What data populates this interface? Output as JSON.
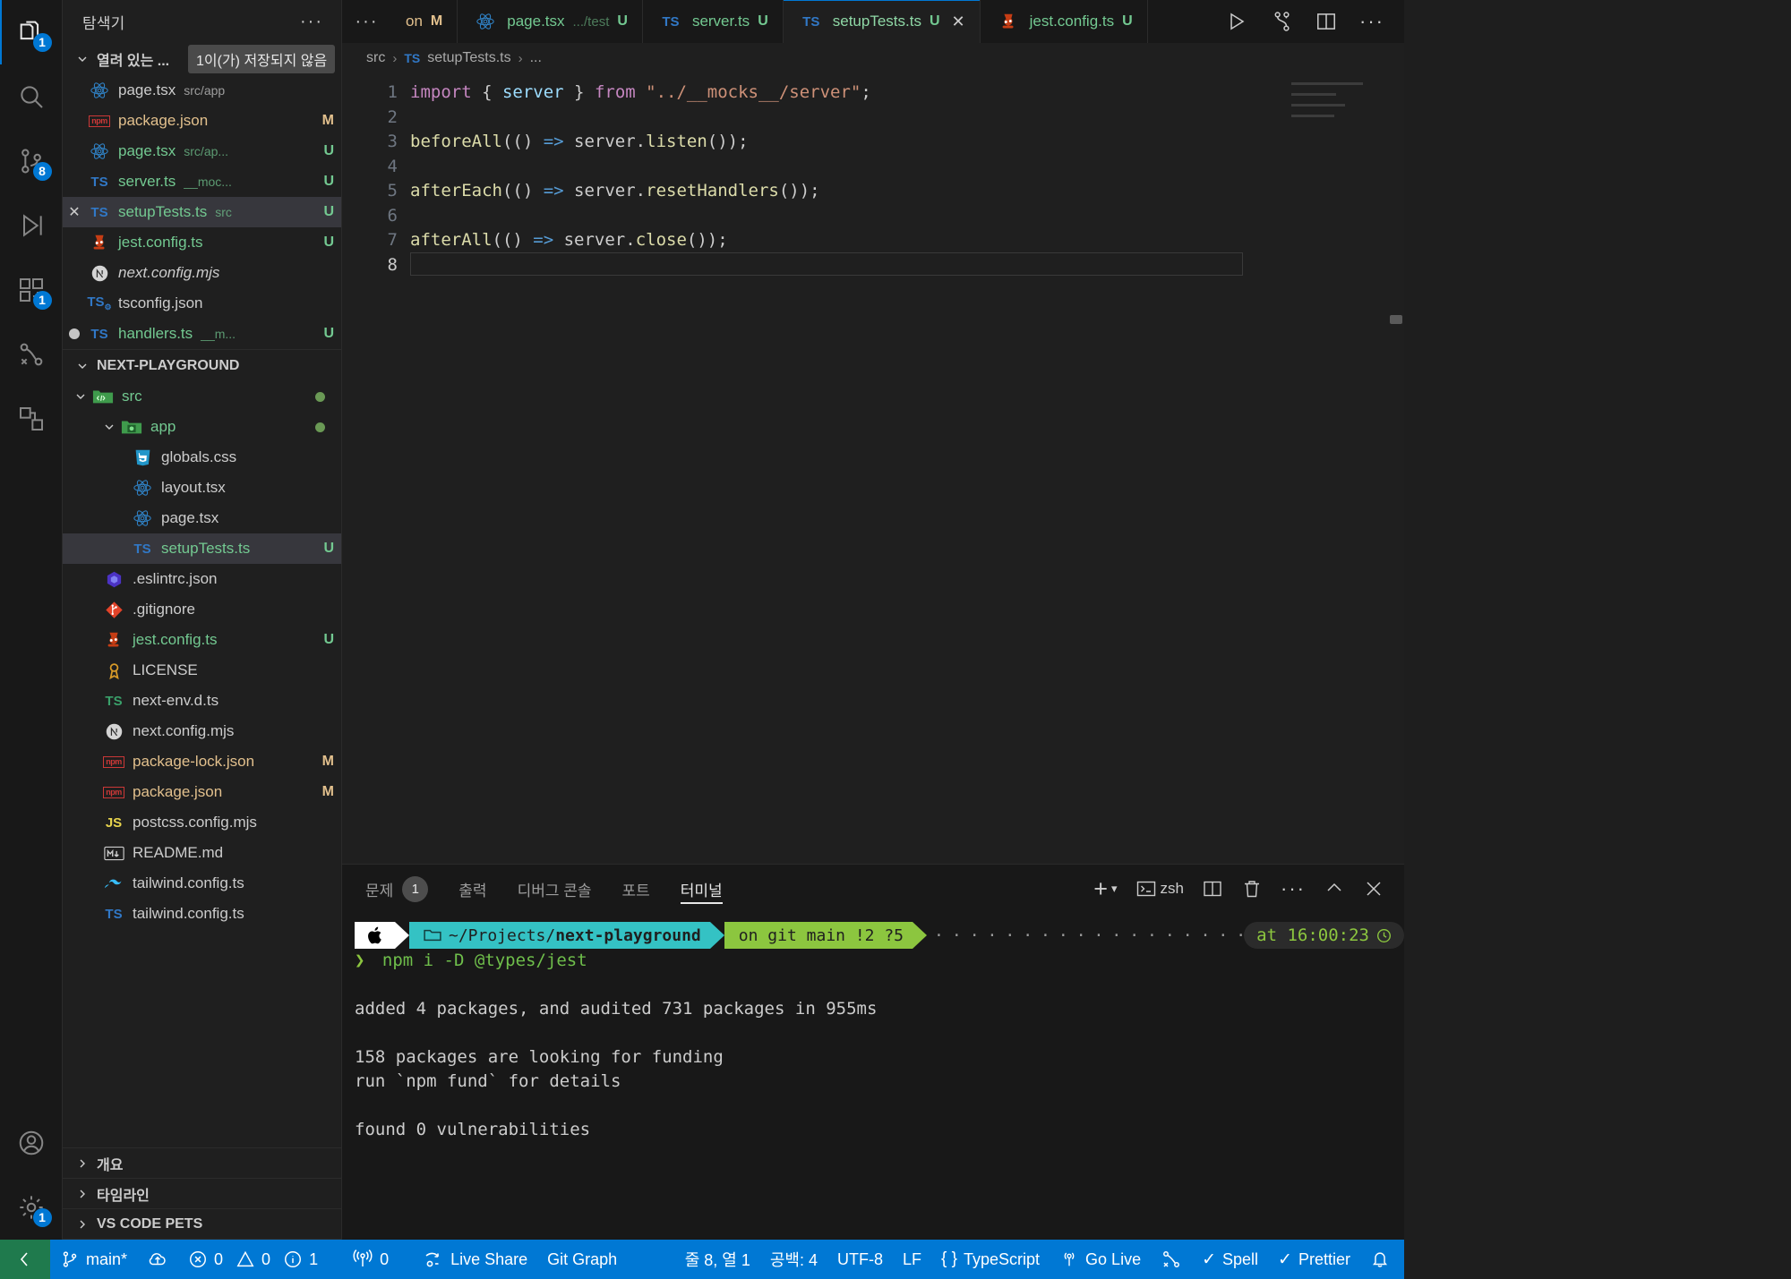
{
  "activity_bar": {
    "items": [
      {
        "name": "explorer",
        "icon": "files-icon",
        "badge": "1",
        "active": true
      },
      {
        "name": "search",
        "icon": "search-icon",
        "badge": ""
      },
      {
        "name": "source-control",
        "icon": "source-control-icon",
        "badge": "8"
      },
      {
        "name": "run-and-debug",
        "icon": "debug-icon",
        "badge": ""
      },
      {
        "name": "extensions",
        "icon": "extensions-icon",
        "badge": "1"
      },
      {
        "name": "remote-explorer",
        "icon": "remote-icon",
        "badge": ""
      },
      {
        "name": "test-explorer",
        "icon": "beaker-icon",
        "badge": ""
      }
    ],
    "bottom": [
      {
        "name": "accounts",
        "icon": "account-icon",
        "badge": ""
      },
      {
        "name": "manage",
        "icon": "gear-icon",
        "badge": "1"
      }
    ]
  },
  "sidebar": {
    "title": "탐색기",
    "more_actions": "···",
    "open_editors": {
      "label": "열려 있는 ...",
      "tooltip": "1이(가) 저장되지 않음",
      "items": [
        {
          "icon": "react-icon",
          "name": "page.tsx",
          "desc": "src/app",
          "badge": "",
          "color": "grey",
          "state": ""
        },
        {
          "icon": "npm-icon",
          "name": "package.json",
          "desc": "",
          "badge": "M",
          "color": "orange",
          "state": ""
        },
        {
          "icon": "react-icon",
          "name": "page.tsx",
          "desc": "src/ap...",
          "badge": "U",
          "color": "green",
          "state": ""
        },
        {
          "icon": "ts-icon",
          "name": "server.ts",
          "desc": "__moc...",
          "badge": "U",
          "color": "green",
          "state": ""
        },
        {
          "icon": "ts-icon",
          "name": "setupTests.ts",
          "desc": "src",
          "badge": "U",
          "color": "green",
          "state": "selected"
        },
        {
          "icon": "jest-icon",
          "name": "jest.config.ts",
          "desc": "",
          "badge": "U",
          "color": "green",
          "state": ""
        },
        {
          "icon": "next-icon",
          "name": "next.config.mjs",
          "desc": "",
          "badge": "",
          "color": "grey",
          "state": "italic"
        },
        {
          "icon": "tsconfig-icon",
          "name": "tsconfig.json",
          "desc": "",
          "badge": "",
          "color": "grey",
          "state": ""
        },
        {
          "icon": "ts-icon",
          "name": "handlers.ts",
          "desc": "__m...",
          "badge": "U",
          "color": "green",
          "state": "dirty"
        }
      ]
    },
    "workspace": {
      "label": "NEXT-PLAYGROUND",
      "items": [
        {
          "icon": "folder-src-icon",
          "name": "src",
          "badge": "",
          "color": "green",
          "indent": 1,
          "expanded": true,
          "dot": "#6a9955"
        },
        {
          "icon": "folder-app-icon",
          "name": "app",
          "badge": "",
          "color": "green",
          "indent": 2,
          "expanded": true,
          "dot": "#6a9955"
        },
        {
          "icon": "css-icon",
          "name": "globals.css",
          "badge": "",
          "color": "grey",
          "indent": 3
        },
        {
          "icon": "react-icon",
          "name": "layout.tsx",
          "badge": "",
          "color": "grey",
          "indent": 3
        },
        {
          "icon": "react-icon",
          "name": "page.tsx",
          "badge": "",
          "color": "grey",
          "indent": 3
        },
        {
          "icon": "ts-icon",
          "name": "setupTests.ts",
          "badge": "U",
          "color": "green",
          "indent": 3,
          "state": "selected"
        },
        {
          "icon": "eslint-icon",
          "name": ".eslintrc.json",
          "badge": "",
          "color": "grey",
          "indent": 2
        },
        {
          "icon": "git-icon",
          "name": ".gitignore",
          "badge": "",
          "color": "grey",
          "indent": 2
        },
        {
          "icon": "jest-icon",
          "name": "jest.config.ts",
          "badge": "U",
          "color": "green",
          "indent": 2
        },
        {
          "icon": "license-icon",
          "name": "LICENSE",
          "badge": "",
          "color": "grey",
          "indent": 2
        },
        {
          "icon": "ts-green-icon",
          "name": "next-env.d.ts",
          "badge": "",
          "color": "grey",
          "indent": 2
        },
        {
          "icon": "next-icon",
          "name": "next.config.mjs",
          "badge": "",
          "color": "grey",
          "indent": 2
        },
        {
          "icon": "npm-icon",
          "name": "package-lock.json",
          "badge": "M",
          "color": "orange",
          "indent": 2
        },
        {
          "icon": "npm-icon",
          "name": "package.json",
          "badge": "M",
          "color": "orange",
          "indent": 2
        },
        {
          "icon": "js-icon",
          "name": "postcss.config.mjs",
          "badge": "",
          "color": "grey",
          "indent": 2
        },
        {
          "icon": "markdown-icon",
          "name": "README.md",
          "badge": "",
          "color": "grey",
          "indent": 2
        },
        {
          "icon": "tailwind-icon",
          "name": "tailwind.config.ts",
          "badge": "",
          "color": "grey",
          "indent": 2
        },
        {
          "icon": "ts-icon",
          "name": "tailwind.config.ts",
          "badge": "",
          "color": "grey",
          "indent": 2,
          "hidden_partial": true
        }
      ]
    },
    "collapsed_sections": [
      {
        "label": "개요",
        "name": "outline"
      },
      {
        "label": "타임라인",
        "name": "timeline"
      },
      {
        "label": "VS CODE PETS",
        "name": "vs-code-pets"
      }
    ]
  },
  "tabs": {
    "items": [
      {
        "icon": "npm-icon",
        "name": "on",
        "desc": "",
        "badge": "M",
        "active": false,
        "clipped": true,
        "color": "orange"
      },
      {
        "icon": "react-icon",
        "name": "page.tsx",
        "desc": ".../test",
        "badge": "U",
        "active": false,
        "color": "green"
      },
      {
        "icon": "ts-icon",
        "name": "server.ts",
        "desc": "",
        "badge": "U",
        "active": false,
        "color": "green"
      },
      {
        "icon": "ts-icon",
        "name": "setupTests.ts",
        "desc": "",
        "badge": "U",
        "active": true,
        "color": "green",
        "closeable": true
      },
      {
        "icon": "jest-icon",
        "name": "jest.config.ts",
        "desc": "",
        "badge": "U",
        "active": false,
        "color": "green"
      }
    ],
    "actions": [
      {
        "name": "run-file-button",
        "icon": "play-icon"
      },
      {
        "name": "source-control-graph-button",
        "icon": "git-fork-icon"
      },
      {
        "name": "split-editor-button",
        "icon": "split-icon"
      },
      {
        "name": "more-actions-button",
        "icon": "ellipsis-icon"
      }
    ]
  },
  "breadcrumb": {
    "parts": [
      "src",
      "setupTests.ts",
      "..."
    ],
    "file_icon": "ts-icon"
  },
  "editor": {
    "language": "TypeScript",
    "lines": [
      {
        "n": "1",
        "tokens": [
          {
            "t": "import ",
            "c": "kw"
          },
          {
            "t": "{ ",
            "c": "punc"
          },
          {
            "t": "server",
            "c": "ident"
          },
          {
            "t": " } ",
            "c": "punc"
          },
          {
            "t": "from ",
            "c": "kw"
          },
          {
            "t": "\"../__mocks__/server\"",
            "c": "str"
          },
          {
            "t": ";",
            "c": "punc"
          }
        ]
      },
      {
        "n": "2",
        "tokens": []
      },
      {
        "n": "3",
        "tokens": [
          {
            "t": "beforeAll",
            "c": "fn"
          },
          {
            "t": "(() ",
            "c": "punc"
          },
          {
            "t": "=>",
            "c": "arrow"
          },
          {
            "t": " server.",
            "c": "punc"
          },
          {
            "t": "listen",
            "c": "fn"
          },
          {
            "t": "());",
            "c": "punc"
          }
        ]
      },
      {
        "n": "4",
        "tokens": []
      },
      {
        "n": "5",
        "tokens": [
          {
            "t": "afterEach",
            "c": "fn"
          },
          {
            "t": "(() ",
            "c": "punc"
          },
          {
            "t": "=>",
            "c": "arrow"
          },
          {
            "t": " server.",
            "c": "punc"
          },
          {
            "t": "resetHandlers",
            "c": "fn"
          },
          {
            "t": "());",
            "c": "punc"
          }
        ]
      },
      {
        "n": "6",
        "tokens": []
      },
      {
        "n": "7",
        "tokens": [
          {
            "t": "afterAll",
            "c": "fn"
          },
          {
            "t": "(() ",
            "c": "punc"
          },
          {
            "t": "=>",
            "c": "arrow"
          },
          {
            "t": " server.",
            "c": "punc"
          },
          {
            "t": "close",
            "c": "fn"
          },
          {
            "t": "());",
            "c": "punc"
          }
        ]
      },
      {
        "n": "8",
        "tokens": [],
        "current": true
      }
    ]
  },
  "panel": {
    "tabs": [
      {
        "label": "문제",
        "count": "1",
        "active": false,
        "name": "problems"
      },
      {
        "label": "출력",
        "count": "",
        "active": false,
        "name": "output"
      },
      {
        "label": "디버그 콘솔",
        "count": "",
        "active": false,
        "name": "debug-console"
      },
      {
        "label": "포트",
        "count": "",
        "active": false,
        "name": "ports"
      },
      {
        "label": "터미널",
        "count": "",
        "active": true,
        "name": "terminal"
      }
    ],
    "actions": {
      "new_terminal": "+",
      "shell_name": "zsh",
      "split": "split-icon",
      "kill": "trash-icon",
      "more": "···",
      "maximize": "chevron-up-icon",
      "close": "close-icon"
    }
  },
  "terminal": {
    "prompt": {
      "apple": "",
      "folder_icon": "folder-icon",
      "path_prefix": "~/Projects/",
      "path_bold": "next-playground",
      "git_text": "on git  main !2 ?5",
      "git_branch_icon": "git-branch-icon",
      "time": "at 16:00:23",
      "clock_icon": "clock-icon"
    },
    "command_symbol": "❯",
    "command": "npm i -D @types/jest",
    "output": [
      "",
      "added 4 packages, and audited 731 packages in 955ms",
      "",
      "158 packages are looking for funding",
      "  run `npm fund` for details",
      "",
      "found 0 vulnerabilities"
    ]
  },
  "statusbar": {
    "remote_icon": "remote-indicator-icon",
    "left": [
      {
        "name": "branch",
        "icon": "git-branch-icon",
        "label": "main*"
      },
      {
        "name": "sync-changes",
        "icon": "cloud-upload-icon",
        "label": ""
      },
      {
        "name": "problems",
        "icon": "error-warning-info-icons",
        "errors": "0",
        "warnings": "0",
        "infos": "1"
      },
      {
        "name": "radio-tower",
        "icon": "radio-tower-icon",
        "label": "0"
      },
      {
        "name": "live-share",
        "icon": "live-share-icon",
        "label": "Live Share"
      },
      {
        "name": "git-graph",
        "icon": "",
        "label": "Git Graph"
      }
    ],
    "right": [
      {
        "name": "cursor-position",
        "label": "줄 8, 열 1"
      },
      {
        "name": "indentation",
        "label": "공백: 4"
      },
      {
        "name": "encoding",
        "label": "UTF-8"
      },
      {
        "name": "eol",
        "label": "LF"
      },
      {
        "name": "language-mode",
        "icon": "braces-icon",
        "label": "TypeScript"
      },
      {
        "name": "go-live",
        "icon": "broadcast-icon",
        "label": "Go Live"
      },
      {
        "name": "remote-tunnel",
        "icon": "tunnel-icon",
        "label": ""
      },
      {
        "name": "spell-checker",
        "icon": "check-icon",
        "label": "Spell"
      },
      {
        "name": "prettier",
        "icon": "check-icon",
        "label": "Prettier"
      },
      {
        "name": "notifications",
        "icon": "bell-icon",
        "label": ""
      }
    ]
  },
  "colors": {
    "accent": "#0078d4",
    "added_green": "#73c991",
    "modified_orange": "#e2c08d",
    "terminal_cyan": "#34c2c4",
    "terminal_green": "#8cc63f"
  }
}
